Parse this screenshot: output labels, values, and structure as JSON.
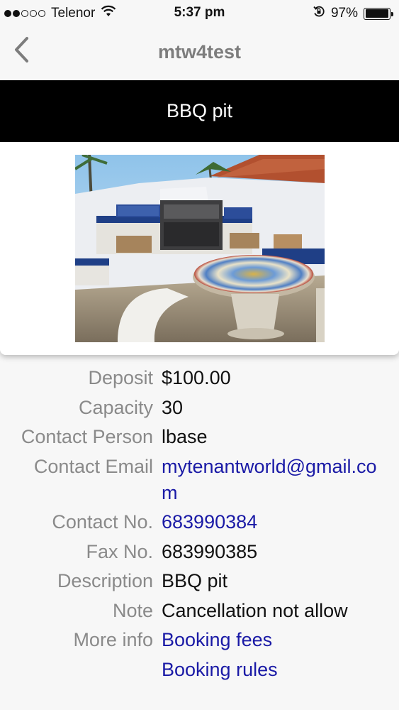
{
  "status_bar": {
    "carrier": "Telenor",
    "time": "5:37 pm",
    "battery_pct": "97%",
    "battery_level": 0.97,
    "signal_bars_filled": 2,
    "signal_bars_total": 5,
    "icons": [
      "wifi-icon",
      "rotation-lock-icon",
      "battery-icon"
    ]
  },
  "nav": {
    "title": "mtw4test",
    "back_icon": "chevron-left-icon"
  },
  "header": {
    "title": "BBQ pit"
  },
  "details": {
    "deposit": {
      "label": "Deposit",
      "value": "$100.00"
    },
    "capacity": {
      "label": "Capacity",
      "value": "30"
    },
    "contact_person": {
      "label": "Contact Person",
      "value": "lbase"
    },
    "contact_email": {
      "label": "Contact Email",
      "value": "mytenantworld@gmail.com"
    },
    "contact_no": {
      "label": "Contact No.",
      "value": "683990384"
    },
    "fax_no": {
      "label": "Fax No.",
      "value": "683990385"
    },
    "description": {
      "label": "Description",
      "value": "BBQ pit"
    },
    "note": {
      "label": "Note",
      "value": "Cancellation not allow"
    },
    "more_info": {
      "label": "More info",
      "links": [
        "Booking fees",
        "Booking rules"
      ]
    }
  },
  "colors": {
    "link": "#1a1aa6",
    "label": "#8a8a8a",
    "nav_title": "#7d7d7d",
    "banner_bg": "#000000"
  }
}
